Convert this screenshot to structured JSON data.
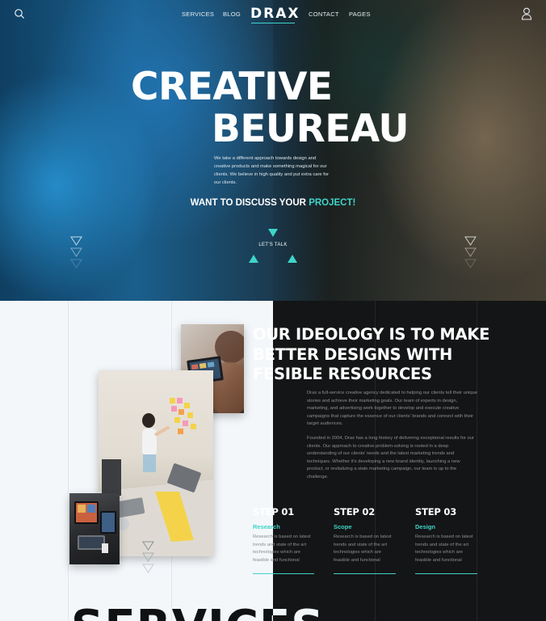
{
  "nav": {
    "links": [
      "SERVICES",
      "BLOG",
      "CONTACT",
      "PAGES"
    ],
    "logo": "DRAX"
  },
  "hero": {
    "title_line1": "CREATIVE",
    "title_line2": "BEUREAU",
    "description": "We take a different approach towards design and creative products and make something magical for our clients. We believe in high quality and put extra care for our clients.",
    "cta_prefix": "WANT TO DISCUSS YOUR ",
    "cta_accent": "PROJECT!",
    "lets_talk": "LET'S TALK"
  },
  "about": {
    "heading_line1": "OUR IDEOLOGY IS TO MAKE",
    "heading_line2": "BETTER DESIGNS  WITH",
    "heading_line3": "FESIBLE RESOURCES",
    "paragraph1": "Drax a full-service creative agency dedicated to helping our clients tell their unique stories and achieve their marketing goals. Our team of experts in design, marketing, and advertising work together to develop and execute creative campaigns that capture the essence of our clients' brands and connect with their target audiences.",
    "paragraph2": "Founded in 2004, Drax has a long history of delivering exceptional results for our clients. Our approach to creative problem-solving is rooted in a deep understanding of our clients' needs and the latest marketing trends and techniques. Whether it's developing a new brand identity, launching a new product, or revitalizing a stale marketing campaign, our team is up to the challenge."
  },
  "steps": [
    {
      "num": "STEP 01",
      "title": "Research",
      "text": "Research is based on latest trends and state of the art technologies which are feasible and functional"
    },
    {
      "num": "STEP 02",
      "title": "Scope",
      "text": "Research is based on latest trends and state of the art technologies which are feasible and functional"
    },
    {
      "num": "STEP 03",
      "title": "Design",
      "text": "Research is based on latest trends and state of the art technologies which are feasible and functional"
    }
  ],
  "services": {
    "title": "SERVICES"
  },
  "colors": {
    "accent": "#3fd4c9",
    "dark_bg": "#141516",
    "light_bg": "#f3f7fa"
  },
  "icons": {
    "search": "search-icon",
    "user": "user-icon"
  }
}
